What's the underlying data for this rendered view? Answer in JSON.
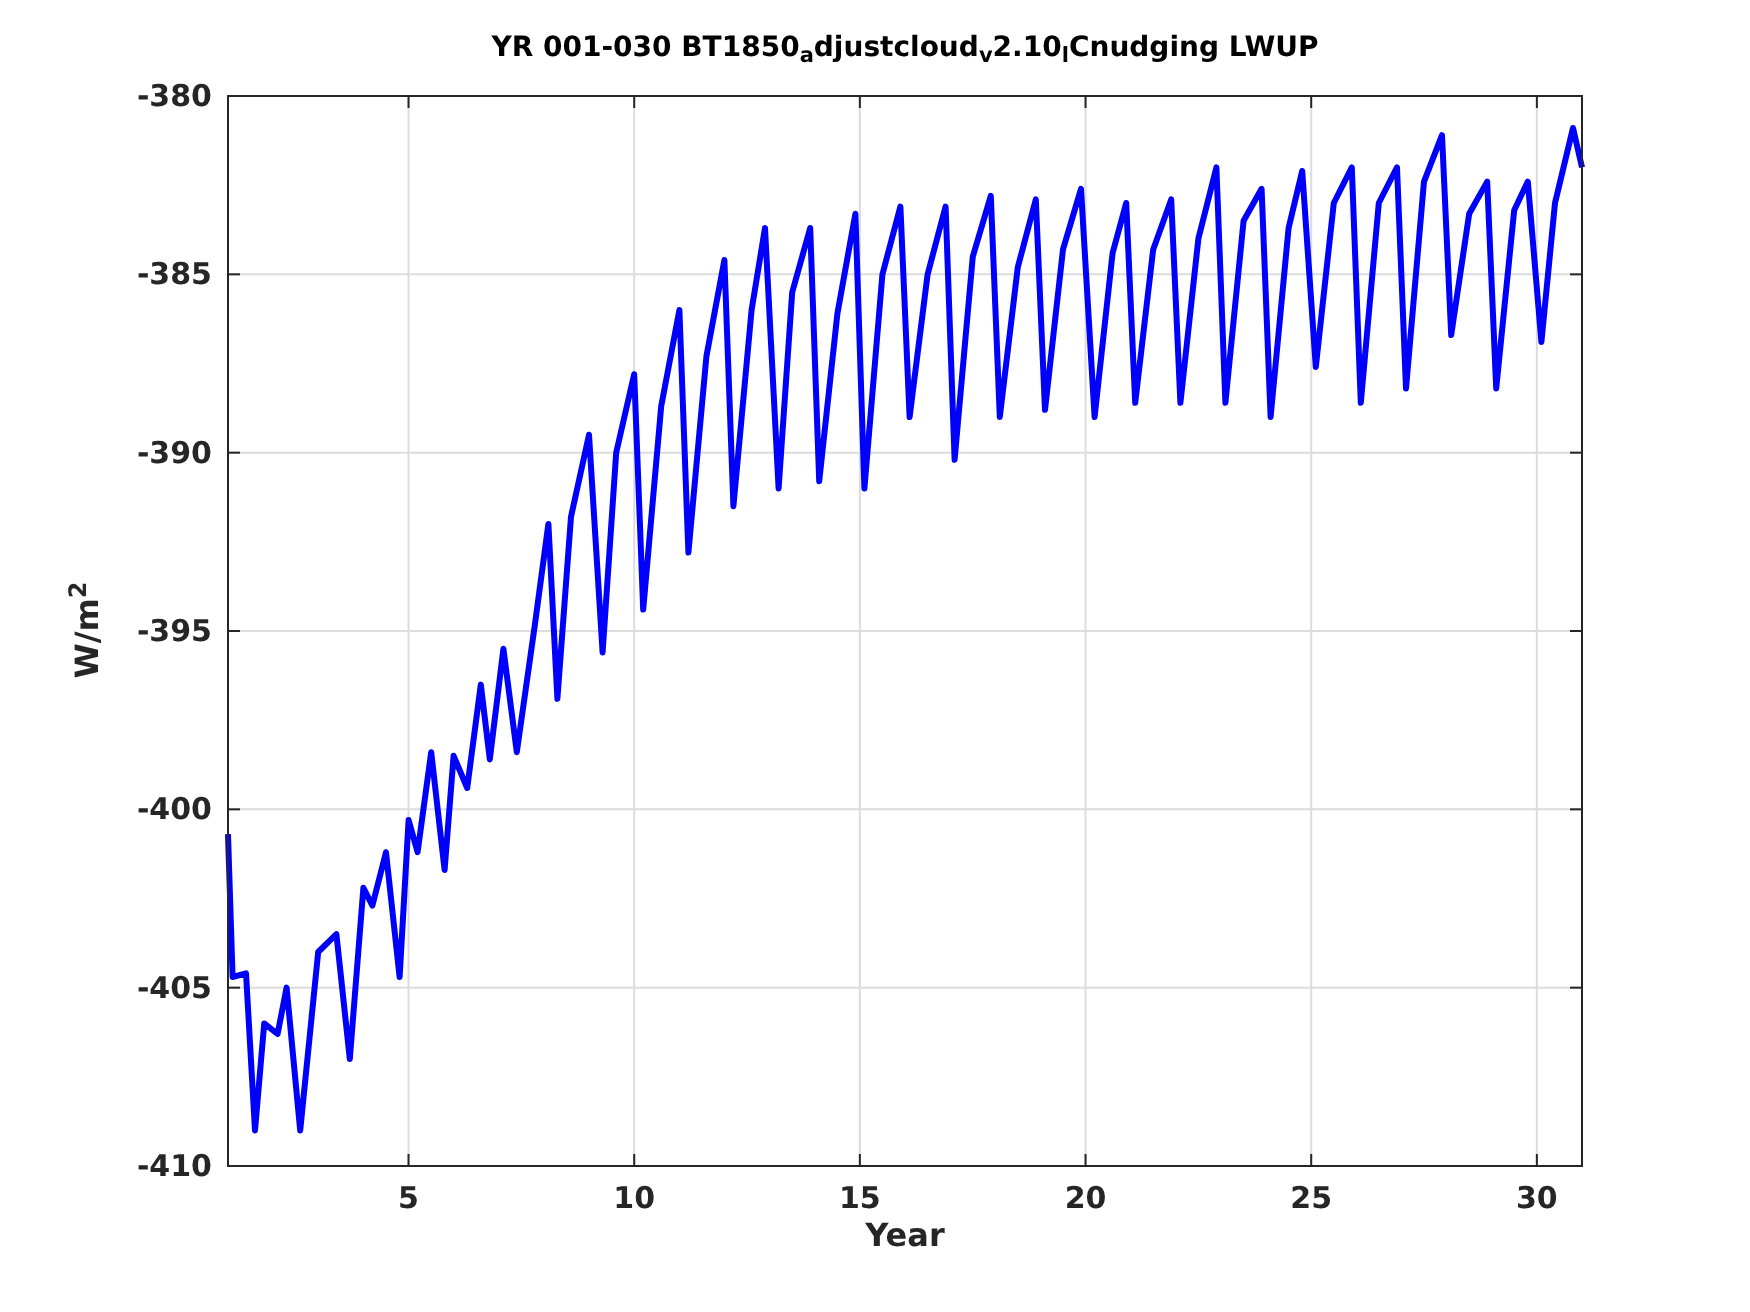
{
  "figure": {
    "chart_data": {
      "type": "line",
      "grid": true,
      "title": "YR 001-030 BT1850$_{a}$djustcloud$_{v}$2.10$_{l}$Cnudging LWUP",
      "xlabel": "Year",
      "ylabel": "W/m$^{2}$",
      "xlim": [
        1,
        31
      ],
      "ylim": [
        -410,
        -380
      ],
      "xticks": [
        5,
        10,
        15,
        20,
        25,
        30
      ],
      "yticks": [
        -410,
        -405,
        -400,
        -395,
        -390,
        -385,
        -380
      ],
      "x": [
        1,
        1.1,
        1.4,
        1.6,
        1.8,
        2.1,
        2.3,
        2.6,
        3.0,
        3.4,
        3.7,
        4.0,
        4.2,
        4.5,
        4.8,
        5.0,
        5.2,
        5.5,
        5.8,
        6.0,
        6.3,
        6.6,
        6.8,
        7.1,
        7.4,
        7.8,
        8.1,
        8.3,
        8.6,
        9.0,
        9.3,
        9.6,
        10.0,
        10.2,
        10.6,
        11.0,
        11.2,
        11.6,
        12.0,
        12.2,
        12.6,
        12.9,
        13.2,
        13.5,
        13.9,
        14.1,
        14.5,
        14.9,
        15.1,
        15.5,
        15.9,
        16.1,
        16.5,
        16.9,
        17.1,
        17.5,
        17.9,
        18.1,
        18.5,
        18.9,
        19.1,
        19.5,
        19.9,
        20.2,
        20.6,
        20.9,
        21.1,
        21.5,
        21.9,
        22.1,
        22.5,
        22.9,
        23.1,
        23.5,
        23.9,
        24.1,
        24.5,
        24.8,
        25.1,
        25.5,
        25.9,
        26.1,
        26.5,
        26.9,
        27.1,
        27.5,
        27.9,
        28.1,
        28.5,
        28.9,
        29.1,
        29.5,
        29.8,
        30.1,
        30.4,
        30.8,
        31
      ],
      "series": [
        {
          "color": "#0000ff",
          "values": [
            -400.7,
            -404.7,
            -404.6,
            -409,
            -406,
            -406.3,
            -405,
            -409,
            -404,
            -403.5,
            -407,
            -402.2,
            -402.7,
            -401.2,
            -404.7,
            -400.3,
            -401.2,
            -398.4,
            -401.7,
            -398.5,
            -399.4,
            -396.5,
            -398.6,
            -395.5,
            -398.4,
            -394.8,
            -392,
            -396.9,
            -391.8,
            -389.5,
            -395.6,
            -390,
            -387.8,
            -394.4,
            -388.7,
            -386,
            -392.8,
            -387.3,
            -384.6,
            -391.5,
            -386,
            -383.7,
            -391,
            -385.5,
            -383.7,
            -390.8,
            -386.1,
            -383.3,
            -391,
            -385,
            -383.1,
            -389,
            -385,
            -383.1,
            -390.2,
            -384.5,
            -382.8,
            -389,
            -384.8,
            -382.9,
            -388.8,
            -384.3,
            -382.6,
            -389,
            -384.4,
            -383,
            -388.6,
            -384.3,
            -382.9,
            -388.6,
            -384,
            -382,
            -388.6,
            -383.5,
            -382.6,
            -389,
            -383.7,
            -382.1,
            -387.6,
            -383,
            -382,
            -388.6,
            -383,
            -382,
            -388.2,
            -382.4,
            -381.1,
            -386.7,
            -383.3,
            -382.4,
            -388.2,
            -383.2,
            -382.4,
            -386.9,
            -383,
            -380.9,
            -382
          ]
        }
      ]
    }
  }
}
